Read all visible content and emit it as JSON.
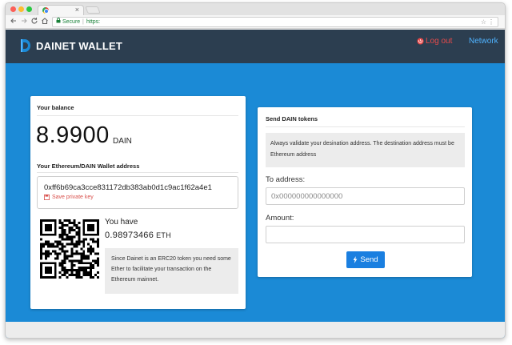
{
  "browser": {
    "tab_close": "×",
    "omnibox": {
      "secure_label": "Secure",
      "separator": "|",
      "url": "https:"
    },
    "icons": {
      "back": "arrow-left-icon",
      "forward": "arrow-right-icon",
      "reload": "reload-icon",
      "home": "home-icon",
      "star": "star-icon",
      "menu": "kebab-menu-icon"
    }
  },
  "header": {
    "brand": "DAINET WALLET",
    "logout_label": "Log out",
    "network_label": "Network"
  },
  "balance_card": {
    "title": "Your balance",
    "balance": "8.9900",
    "balance_unit": "DAIN",
    "address_title": "Your Ethereum/DAIN Wallet address",
    "address": "0xff6b69ca3cce831172db383ab0d1c9ac1f62a4e1",
    "save_key_label": "Save private key",
    "you_have_label": "You have",
    "eth_amount": "0.98973466",
    "eth_unit": "ETH",
    "eth_info": "Since Dainet is an ERC20 token you need some Ether to facilitate your transaction on the Ethereum mainnet."
  },
  "send_card": {
    "title": "Send DAIN tokens",
    "info": "Always validate your desination address. The destination address must be Ethereum address",
    "to_label": "To address:",
    "to_placeholder": "0x000000000000000",
    "amount_label": "Amount:",
    "amount_value": "",
    "send_label": "Send"
  },
  "colors": {
    "accent": "#1b8ad6",
    "appbar": "#2c3e50",
    "logout": "#e84a4a",
    "network": "#4fb3ff",
    "button": "#1a7fe0"
  }
}
